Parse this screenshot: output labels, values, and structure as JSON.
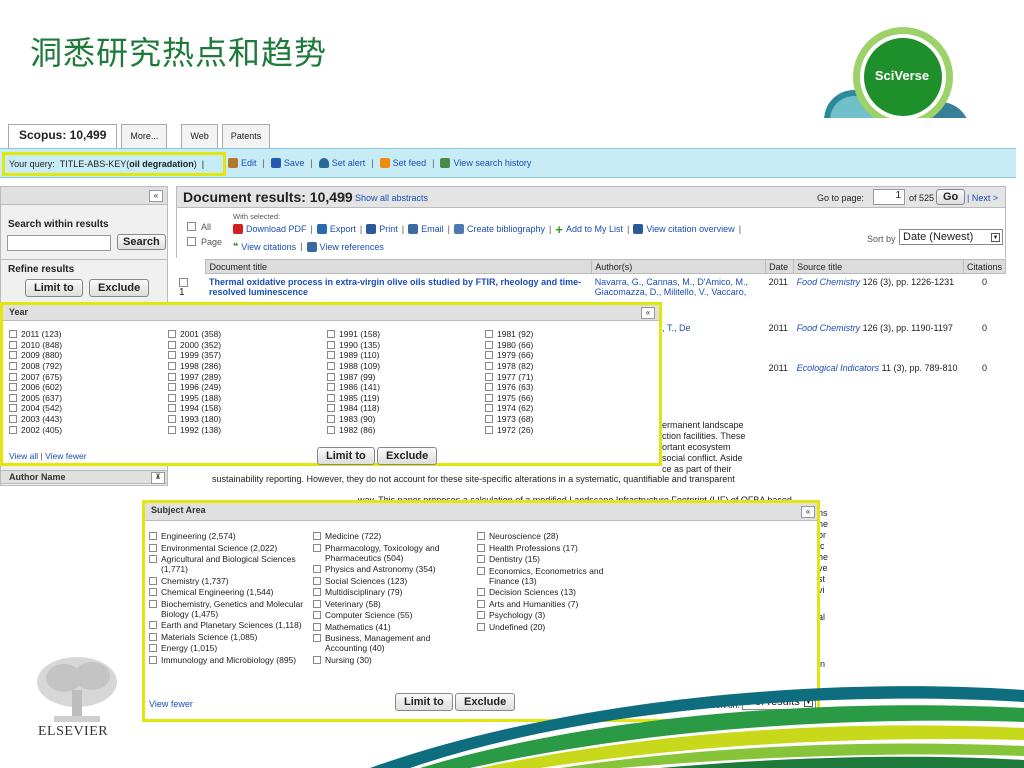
{
  "slide": {
    "title": "洞悉研究热点和趋势"
  },
  "logo": {
    "text": "SciVerse"
  },
  "tabs": [
    {
      "label": "Scopus: 10,499",
      "active": true
    },
    {
      "label": "More...",
      "active": false
    },
    {
      "label": "Web",
      "active": false
    },
    {
      "label": "Patents",
      "active": false
    }
  ],
  "query": {
    "prefix": "Your query:",
    "field": "TITLE-ABS-KEY(",
    "term": "oil degradation",
    "suffix": ")",
    "actions": [
      "Edit",
      "Save",
      "Set alert",
      "Set feed",
      "View search history"
    ]
  },
  "left": {
    "search_heading": "Search within results",
    "search_button": "Search",
    "refine_heading": "Refine results",
    "limit_button": "Limit to",
    "exclude_button": "Exclude",
    "author_heading": "Author Name"
  },
  "results": {
    "title": "Document results: 10,499",
    "show_abstracts": "Show all abstracts",
    "goto_label": "Go to page:",
    "page_value": "1",
    "page_of": "of 525",
    "go_button": "Go",
    "next": "| Next >",
    "with_selected": "With selected:",
    "all_label": "All",
    "page_label": "Page",
    "actions_row1": [
      "Download PDF",
      "Export",
      "Print",
      "Email",
      "Create bibliography",
      "Add to My List",
      "View citation overview"
    ],
    "actions_row2": [
      "View citations",
      "View references"
    ],
    "sort_label": "Sort by",
    "sort_value": "Date (Newest)",
    "columns": [
      "Document title",
      "Author(s)",
      "Date",
      "Source title",
      "Citations"
    ],
    "rows": [
      {
        "num": "1",
        "title": "Thermal oxidative process in extra-virgin olive oils studied by FTIR, rheology and time-resolved luminescence",
        "authors": "Navarra, G., Cannas, M., D'Amico, M., Giacomazza, D., Militello, V., Vaccaro,",
        "date": "2011",
        "journal": "Food Chemistry",
        "source": "126 (3), pp. 1226-1231",
        "citations": "0"
      },
      {
        "num": "",
        "title": "",
        "authors": "erkaert, B., Cucu, T., De",
        "date": "2011",
        "journal": "Food Chemistry",
        "source": "126 (3), pp. 1190-1197",
        "citations": "0"
      },
      {
        "num": "",
        "title": "",
        "authors": "",
        "date": "2011",
        "journal": "Ecological Indicators",
        "source": "11 (3), pp. 789-810",
        "citations": "0"
      }
    ],
    "abstract_lines": [
      "ermanent landscape",
      "ction facilities. These",
      "ortant ecosystem",
      "social conflict. Aside",
      "ce as part of their"
    ],
    "abstract_full1": "sustainability reporting. However, they do not account for these site-specific alterations in a systematic, quantifiable and transparent",
    "abstract_full2": "way. This paper proposes a calculation of a modified Landscape Infrastructure Footprint (LIF) of OFBA based",
    "right_fragments": [
      "ns",
      "ne",
      "or",
      "ic",
      "he",
      "ve",
      "st",
      "vi",
      "al",
      "in"
    ]
  },
  "year_popup": {
    "title": "Year",
    "columns": [
      [
        "2011 (123)",
        "2010 (848)",
        "2009 (880)",
        "2008 (792)",
        "2007 (675)",
        "2006 (602)",
        "2005 (637)",
        "2004 (542)",
        "2003 (443)",
        "2002 (405)"
      ],
      [
        "2001 (358)",
        "2000 (352)",
        "1999 (357)",
        "1998 (286)",
        "1997 (289)",
        "1996 (249)",
        "1995 (188)",
        "1994 (158)",
        "1993 (180)",
        "1992 (138)"
      ],
      [
        "1991 (158)",
        "1990 (135)",
        "1989 (110)",
        "1988 (109)",
        "1987 (99)",
        "1986 (141)",
        "1985 (119)",
        "1984 (118)",
        "1983 (90)",
        "1982 (86)"
      ],
      [
        "1981 (92)",
        "1980 (66)",
        "1979 (66)",
        "1978 (82)",
        "1977 (71)",
        "1976 (63)",
        "1975 (66)",
        "1974 (62)",
        "1973 (68)",
        "1972 (26)"
      ]
    ],
    "view_all": "View all",
    "view_fewer": "View fewer",
    "limit_button": "Limit to",
    "exclude_button": "Exclude"
  },
  "subject_popup": {
    "title": "Subject Area",
    "columns": [
      [
        "Engineering (2,574)",
        "Environmental Science (2,022)",
        "Agricultural and Biological Sciences (1,771)",
        "Chemistry (1,737)",
        "Chemical Engineering (1,544)",
        "Biochemistry, Genetics and Molecular Biology (1,475)",
        "Earth and Planetary Sciences (1,118)",
        "Materials Science (1,085)",
        "Energy (1,015)",
        "Immunology and Microbiology (895)"
      ],
      [
        "Medicine (722)",
        "Pharmacology, Toxicology and Pharmaceutics (504)",
        "Physics and Astronomy (354)",
        "Social Sciences (123)",
        "Multidisciplinary (79)",
        "Veterinary (58)",
        "Computer Science (55)",
        "Mathematics (41)",
        "Business, Management and Accounting (40)",
        "Nursing (30)"
      ],
      [
        "Neuroscience (28)",
        "Health Professions (17)",
        "Dentistry (15)",
        "Economics, Econometrics and Finance (13)",
        "Decision Sciences (13)",
        "Arts and Humanities (7)",
        "Psychology (3)",
        "Undefined (20)"
      ]
    ],
    "view_fewer": "View fewer",
    "limit_button": "Limit to",
    "exclude_button": "Exclude",
    "sort_label": "Sort on:",
    "sort_value": "# of results"
  },
  "footer": {
    "publisher": "ELSEVIER"
  },
  "colors": {
    "title_green": "#1d7a3a",
    "highlight_yellow": "#e3e60d",
    "link_blue": "#1a4db8",
    "query_bar": "#c8ecf5"
  }
}
